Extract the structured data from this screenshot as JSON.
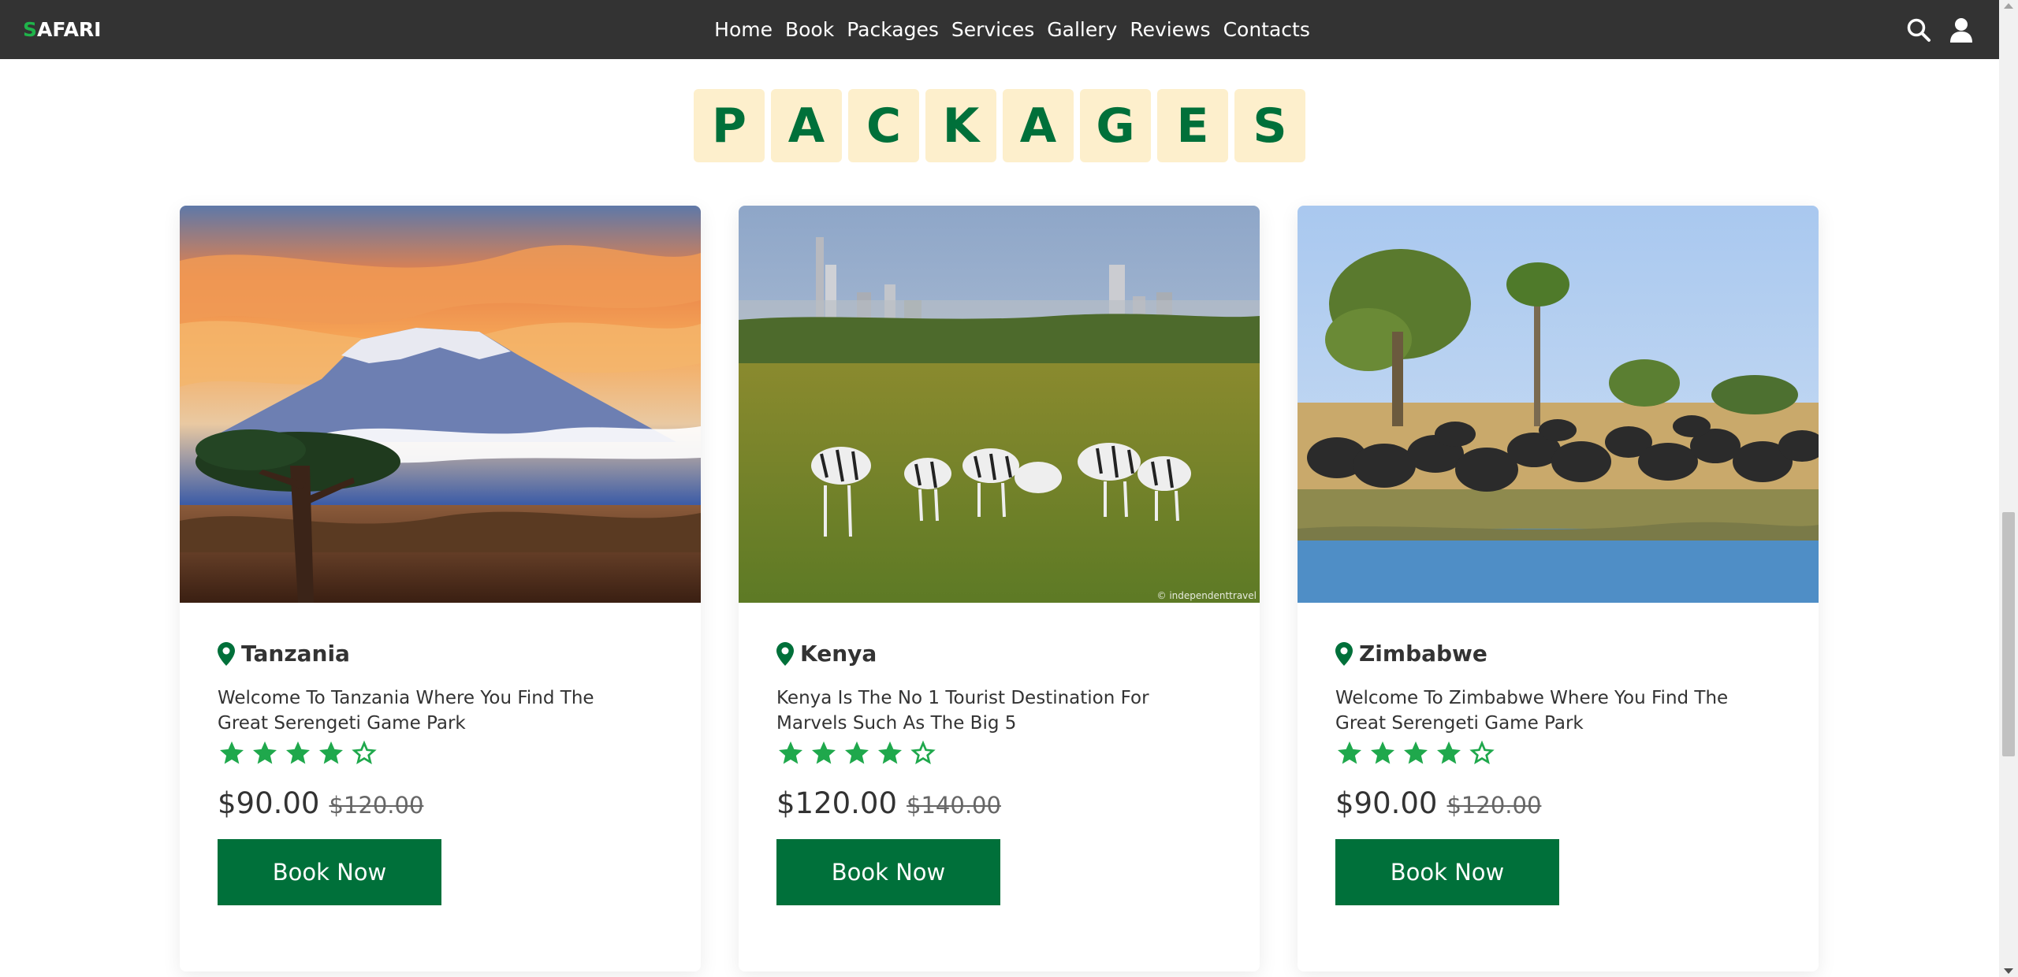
{
  "header": {
    "logo_accent": "S",
    "logo_rest": "AFARI",
    "nav": [
      "Home",
      "Book",
      "Packages",
      "Services",
      "Gallery",
      "Reviews",
      "Contacts"
    ],
    "icons": [
      "search-icon",
      "user-icon"
    ]
  },
  "title": {
    "letters": [
      "P",
      "A",
      "C",
      "K",
      "A",
      "G",
      "E",
      "S"
    ],
    "tile_color": "#fdefcc",
    "text_color": "#00703a"
  },
  "colors": {
    "header_bg": "#333333",
    "brand_green": "#00703a",
    "star_green": "#1fa84c"
  },
  "cards": [
    {
      "location": "Tanzania",
      "description": "Welcome To Tanzania Where You Find The Great Serengeti Game Park",
      "rating": 4,
      "rating_max": 5,
      "price": "$90.00",
      "old_price": "$120.00",
      "button": "Book Now",
      "image": "kilimanjaro-sunset-image"
    },
    {
      "location": "Kenya",
      "description": "Kenya Is The No 1 Tourist Destination For Marvels Such As The Big 5",
      "rating": 4,
      "rating_max": 5,
      "price": "$120.00",
      "old_price": "$140.00",
      "button": "Book Now",
      "image": "nairobi-zebras-image",
      "credit": "© independenttravel"
    },
    {
      "location": "Zimbabwe",
      "description": "Welcome To Zimbabwe Where You Find The Great Serengeti Game Park",
      "rating": 4,
      "rating_max": 5,
      "price": "$90.00",
      "old_price": "$120.00",
      "button": "Book Now",
      "image": "buffalo-herd-image"
    }
  ]
}
